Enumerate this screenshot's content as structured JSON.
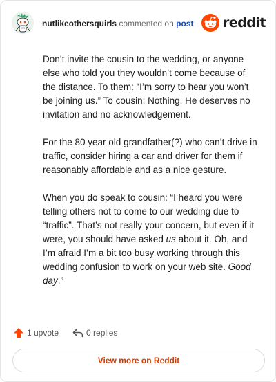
{
  "header": {
    "username": "nutlikeothersquirls",
    "commented_on": "commented on",
    "post_link": "post",
    "brand_name": "reddit"
  },
  "comment": {
    "p1": "Don’t invite the cousin to the wedding, or anyone else who told you they wouldn’t come because of the distance. To them: “I’m sorry to hear you won’t be joining us.” To cousin: Nothing. He deserves no invitation and no acknowledgement.",
    "p2": "For the 80 year old grandfather(?) who can’t drive in traffic, consider hiring a car and driver for them if reasonably affordable and as a nice gesture.",
    "p3_part1": "When you do speak to cousin: “I heard you were telling others not to come to our wedding due to “traffic”. That’s not really your concern, but even if it were, you should have asked ",
    "p3_em1": "us",
    "p3_part2": " about it. Oh, and I’m afraid I’m a bit too busy working through this wedding confusion to work on your web site. ",
    "p3_em2": "Good day",
    "p3_part3": ".”"
  },
  "footer": {
    "upvotes": "1 upvote",
    "replies": "0 replies",
    "view_more": "View more on Reddit"
  },
  "colors": {
    "upvote": "#ff4500",
    "link": "#1a4bb5",
    "view_more": "#d93a00",
    "reddit_logo": "#ff4500"
  },
  "icons": {
    "upvote": "upvote-arrow-icon",
    "replies": "reply-arrow-icon",
    "logo": "reddit-snoo-icon"
  }
}
